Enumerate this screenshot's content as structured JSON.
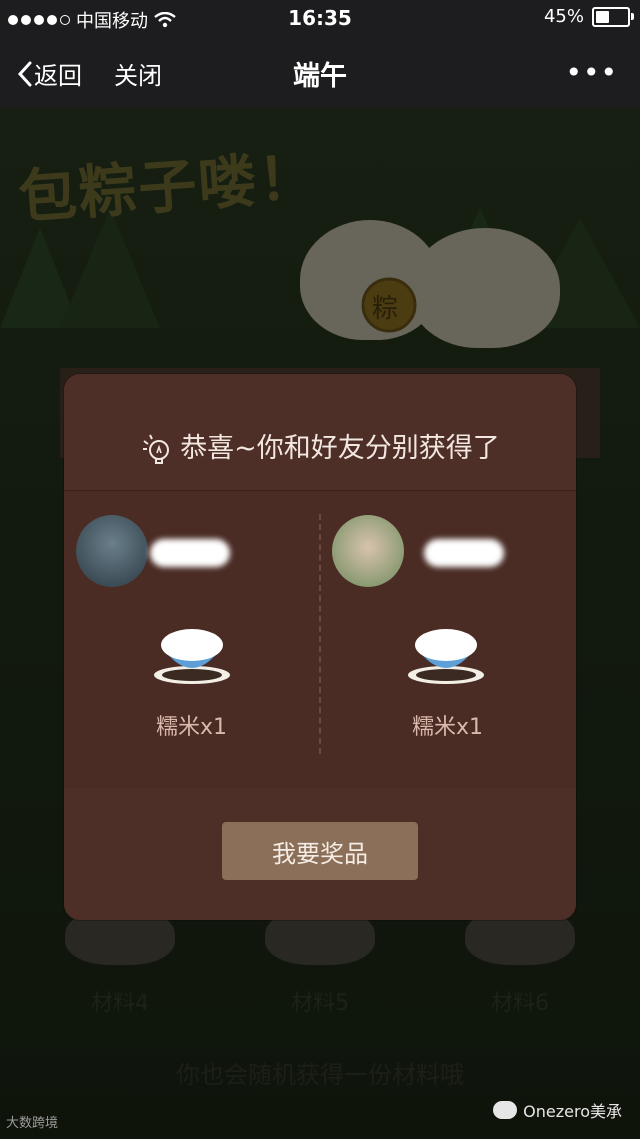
{
  "status_bar": {
    "carrier": "中国移动",
    "time": "16:35",
    "battery": "45%",
    "battery_level": 0.45
  },
  "nav": {
    "back_label": "返回",
    "close_label": "关闭",
    "title": "端午",
    "more_label": "•••"
  },
  "game": {
    "title": "包粽子喽！",
    "coin_text": "粽",
    "materials": [
      "材料4",
      "材料5",
      "材料6"
    ],
    "hint": "你也会随机获得一份材料哦"
  },
  "modal": {
    "title": "恭喜~你和好友分别获得了",
    "left": {
      "reward": "糯米x1"
    },
    "right": {
      "reward": "糯米x1"
    },
    "button_label": "我要奖品"
  },
  "watermark": {
    "left": "大数跨境",
    "right": "Onezero美承"
  },
  "colors": {
    "modal_bg": "#4a2c25",
    "button_bg": "#8b6f58",
    "reward_text": "#d9b9aa"
  }
}
